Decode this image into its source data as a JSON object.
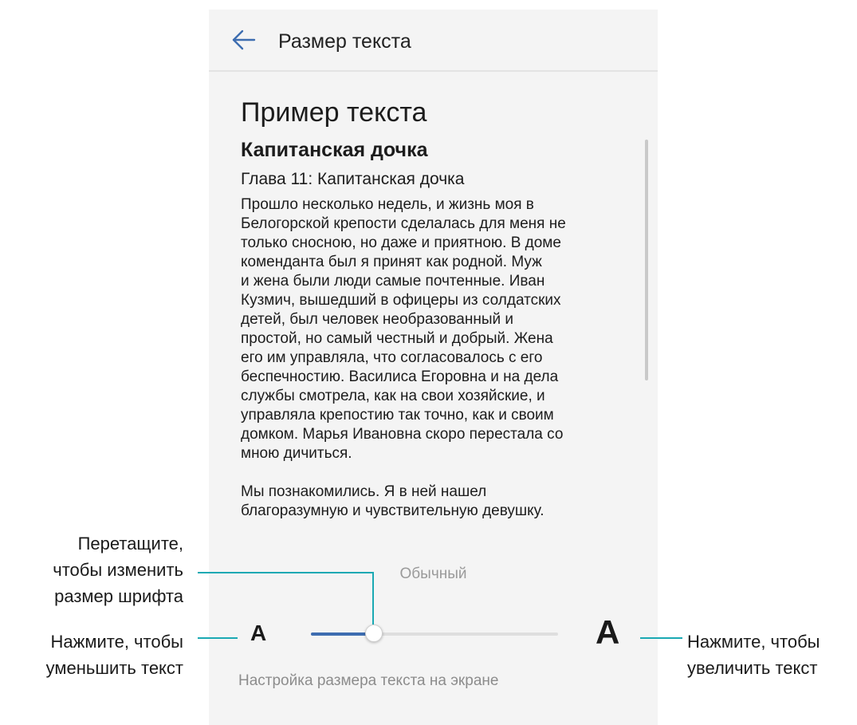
{
  "app_bar": {
    "title": "Размер текста",
    "back_icon": "arrow-left-icon"
  },
  "preview": {
    "heading": "Пример текста",
    "book_title": "Капитанская дочка",
    "chapter": "Глава 11: Капитанская дочка",
    "paragraph1_lines": [
      "Прошло несколько недель, и жизнь моя в",
      "Белогорской крепости сделалась для меня не",
      "только сносною, но даже и приятною. В доме",
      "коменданта был я принят как родной. Муж",
      "и жена были люди самые почтенные. Иван",
      "Кузмич, вышедший в офицеры из солдатских",
      "детей, был человек необразованный и",
      "простой, но самый честный и добрый. Жена",
      "его им управляла, что согласовалось с его",
      "беспечностию. Василиса Егоровна и на дела",
      "службы смотрела, как на свои хозяйские, и",
      "управляла крепостию так точно, как и своим",
      "домком. Марья Ивановна скоро перестала со",
      "мною дичиться."
    ],
    "paragraph2_lines": [
      "Мы познакомились. Я в ней нашел",
      "благоразумную и чувствительную девушку."
    ]
  },
  "size_control": {
    "value_label": "Обычный",
    "decrease_label": "A",
    "increase_label": "A",
    "slider_level": 0.25,
    "slider_accent": "#3d6db0"
  },
  "footer": {
    "label": "Настройка размера текста на экране"
  },
  "callouts": {
    "drag_lines": [
      "Перетащите,",
      "чтобы изменить",
      "размер шрифта"
    ],
    "decrease_lines": [
      "Нажмите, чтобы",
      "уменьшить текст"
    ],
    "increase_lines": [
      "Нажмите, чтобы",
      "увеличить текст"
    ],
    "line_color": "#1aa9b3"
  }
}
